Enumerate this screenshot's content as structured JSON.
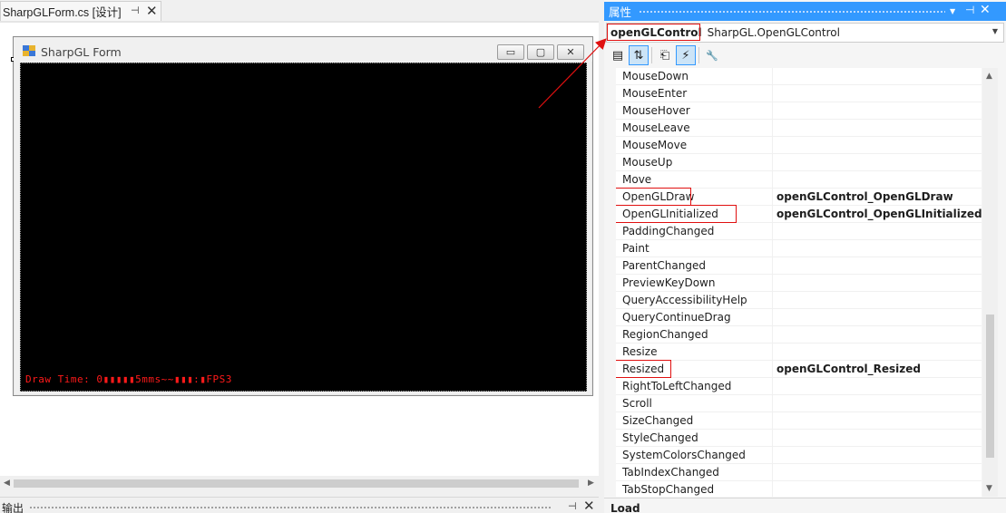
{
  "document_tab": {
    "label": "SharpGLForm.cs [设计]",
    "pin_icon": "pin-icon",
    "close_icon": "close-icon"
  },
  "form": {
    "title": "SharpGL Form",
    "minimize_glyph": "▭",
    "maximize_glyph": "▢",
    "close_glyph": "✕",
    "gl_overlay_text": "Draw Time: 0▮▮▮▮▮5mms~~▮▮▮:▮FPS3",
    "gl_text_color": "#ff1a1a",
    "gl_background": "#000000"
  },
  "output_panel": {
    "label": "输出"
  },
  "properties": {
    "title": "属性",
    "accent_color": "#3399ff",
    "object_name": "openGLControl",
    "object_type": "SharpGL.OpenGLControl",
    "toolbar": [
      {
        "name": "categorized-icon",
        "glyph": "▤",
        "active": false
      },
      {
        "name": "alphabetical-icon",
        "glyph": "⇅",
        "active": true
      },
      {
        "name": "properties-icon",
        "glyph": "⎗",
        "active": false
      },
      {
        "name": "events-icon",
        "glyph": "⚡",
        "active": true
      },
      {
        "name": "property-pages-icon",
        "glyph": "🔧",
        "active": false
      }
    ],
    "rows": [
      {
        "name": "MouseDown",
        "value": ""
      },
      {
        "name": "MouseEnter",
        "value": ""
      },
      {
        "name": "MouseHover",
        "value": ""
      },
      {
        "name": "MouseLeave",
        "value": ""
      },
      {
        "name": "MouseMove",
        "value": ""
      },
      {
        "name": "MouseUp",
        "value": ""
      },
      {
        "name": "Move",
        "value": ""
      },
      {
        "name": "OpenGLDraw",
        "value": "openGLControl_OpenGLDraw",
        "highlighted": true
      },
      {
        "name": "OpenGLInitialized",
        "value": "openGLControl_OpenGLInitialized",
        "highlighted": true
      },
      {
        "name": "PaddingChanged",
        "value": ""
      },
      {
        "name": "Paint",
        "value": ""
      },
      {
        "name": "ParentChanged",
        "value": ""
      },
      {
        "name": "PreviewKeyDown",
        "value": ""
      },
      {
        "name": "QueryAccessibilityHelp",
        "value": ""
      },
      {
        "name": "QueryContinueDrag",
        "value": ""
      },
      {
        "name": "RegionChanged",
        "value": ""
      },
      {
        "name": "Resize",
        "value": ""
      },
      {
        "name": "Resized",
        "value": "openGLControl_Resized",
        "highlighted": true
      },
      {
        "name": "RightToLeftChanged",
        "value": ""
      },
      {
        "name": "Scroll",
        "value": ""
      },
      {
        "name": "SizeChanged",
        "value": ""
      },
      {
        "name": "StyleChanged",
        "value": ""
      },
      {
        "name": "SystemColorsChanged",
        "value": ""
      },
      {
        "name": "TabIndexChanged",
        "value": ""
      },
      {
        "name": "TabStopChanged",
        "value": ""
      }
    ],
    "description_label": "Load",
    "highlight_color": "#e01010"
  }
}
